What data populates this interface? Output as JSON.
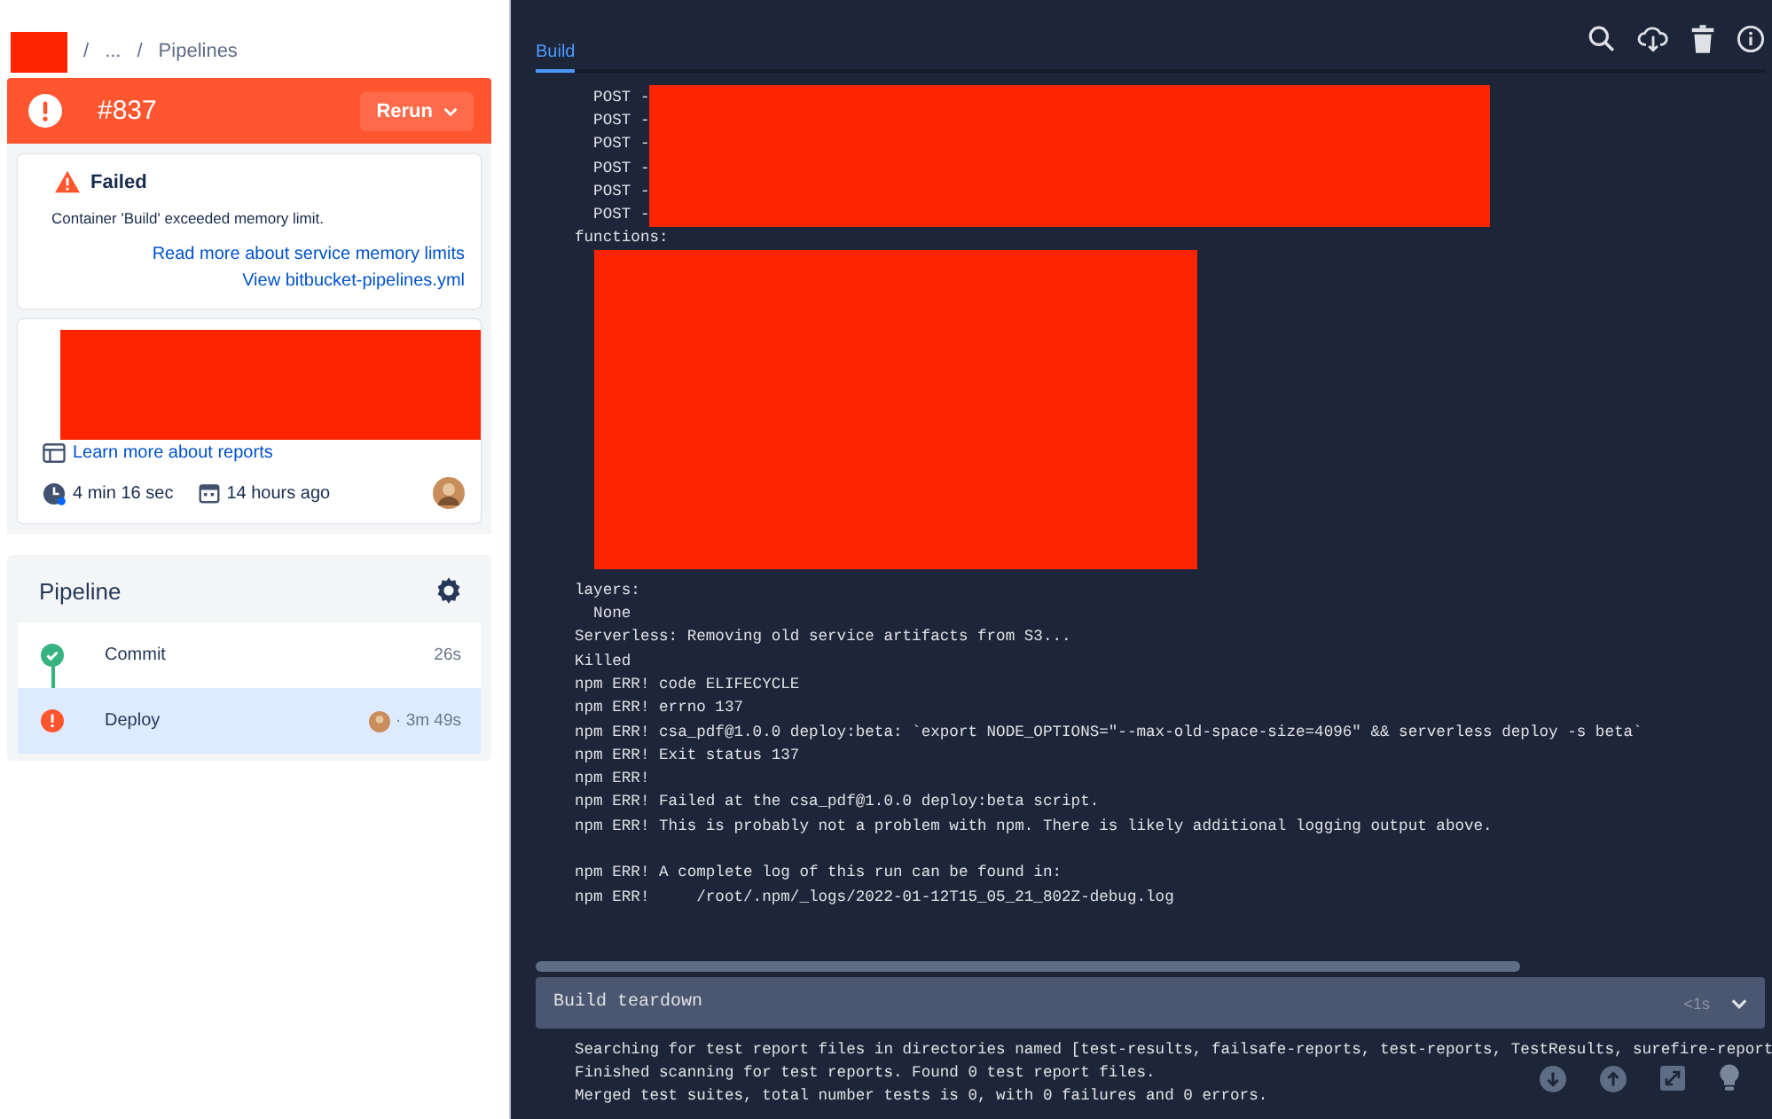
{
  "breadcrumb": [
    {
      "kind": "redacted"
    },
    {
      "kind": "separator",
      "text": "/"
    },
    {
      "kind": "link",
      "text": "..."
    },
    {
      "kind": "separator",
      "text": "/"
    },
    {
      "kind": "link",
      "text": "Pipelines"
    }
  ],
  "header": {
    "number": "#837",
    "failed": true,
    "rerun": "Rerun"
  },
  "failure": {
    "title": "Failed",
    "message": "Container 'Build' exceeded memory limit.",
    "links": [
      "Read more about service memory limits",
      "View bitbucket-pipelines.yml"
    ]
  },
  "details": {
    "reports_link": "Learn more about reports",
    "duration": "4 min 16 sec",
    "started": "14 hours ago"
  },
  "pipeline": {
    "title": "Pipeline",
    "steps": [
      {
        "name": "Commit",
        "failed": false,
        "duration": "26s",
        "selected": false,
        "avatar": false
      },
      {
        "name": "Deploy",
        "failed": true,
        "duration": "· 3m 49s",
        "selected": true,
        "avatar": true
      }
    ]
  },
  "log": {
    "tabs": [
      {
        "label": "Build",
        "selected": true
      }
    ],
    "lines": [
      {
        "kind": "redacted",
        "text": "  POST -"
      },
      {
        "kind": "redacted",
        "text": "  POST -"
      },
      {
        "kind": "redacted",
        "text": "  POST -"
      },
      {
        "kind": "redacted",
        "text": "  POST -"
      },
      {
        "kind": "redacted",
        "text": "  POST -"
      },
      {
        "kind": "redacted",
        "text": "  POST -"
      },
      {
        "kind": "text",
        "text": "functions:"
      },
      {
        "kind": "redacted_block"
      },
      {
        "kind": "text",
        "text": "layers:"
      },
      {
        "kind": "text",
        "text": "  None"
      },
      {
        "kind": "text",
        "text": "Serverless: Removing old service artifacts from S3..."
      },
      {
        "kind": "text",
        "text": "Killed"
      },
      {
        "kind": "text",
        "text": "npm ERR! code ELIFECYCLE"
      },
      {
        "kind": "text",
        "text": "npm ERR! errno 137"
      },
      {
        "kind": "text",
        "text": "npm ERR! csa_pdf@1.0.0 deploy:beta: `export NODE_OPTIONS=\"--max-old-space-size=4096\" && serverless deploy -s beta`"
      },
      {
        "kind": "text",
        "text": "npm ERR! Exit status 137"
      },
      {
        "kind": "text",
        "text": "npm ERR!"
      },
      {
        "kind": "text",
        "text": "npm ERR! Failed at the csa_pdf@1.0.0 deploy:beta script."
      },
      {
        "kind": "text",
        "text": "npm ERR! This is probably not a problem with npm. There is likely additional logging output above."
      },
      {
        "kind": "blank"
      },
      {
        "kind": "text",
        "text": "npm ERR! A complete log of this run can be found in:"
      },
      {
        "kind": "text",
        "text": "npm ERR!     /root/.npm/_logs/2022-01-12T15_05_21_802Z-debug.log"
      }
    ]
  },
  "teardown": {
    "title": "Build teardown",
    "duration": "<1s",
    "expanded": true,
    "lines": [
      "Searching for test report files in directories named [test-results, failsafe-reports, test-reports, TestResults, surefire-report",
      "Finished scanning for test reports. Found 0 test report files.",
      "Merged test suites, total number tests is 0, with 0 failures and 0 errors."
    ]
  }
}
